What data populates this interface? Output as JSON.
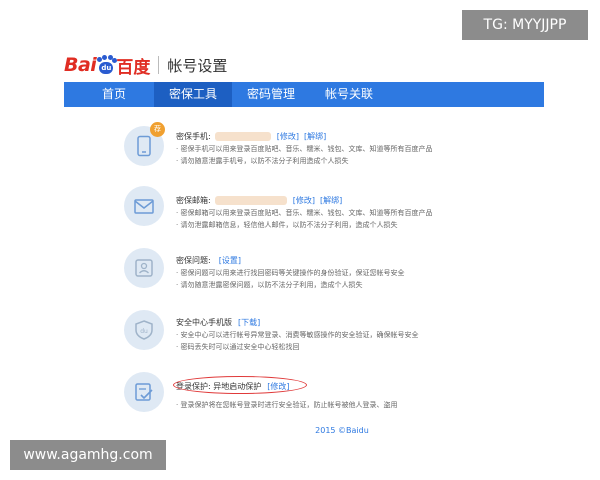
{
  "watermarks": {
    "top": "TG: MYYJJPP",
    "bottom": "www.agamhg.com"
  },
  "header": {
    "logo_latin": "Bai",
    "logo_paw_text": "du",
    "logo_cn": "百度",
    "title": "帐号设置"
  },
  "nav": [
    {
      "label": "首页",
      "active": false
    },
    {
      "label": "密保工具",
      "active": true
    },
    {
      "label": "密码管理",
      "active": false
    },
    {
      "label": "帐号关联",
      "active": false
    }
  ],
  "sections": [
    {
      "icon": "phone-icon",
      "badge": "荐",
      "title": "密保手机:",
      "links": [
        "[修改]",
        "[解绑]"
      ],
      "lines": [
        "· 密保手机可以用来登录百度贴吧、音乐、糯米、钱包、文库、知道等所有百度产品",
        "· 请勿随意泄露手机号，以防不法分子利用造成个人损失"
      ]
    },
    {
      "icon": "mail-icon",
      "title": "密保邮箱:",
      "links": [
        "[修改]",
        "[解绑]"
      ],
      "lines": [
        "· 密保邮箱可以用来登录百度贴吧、音乐、糯米、钱包、文库、知道等所有百度产品",
        "· 请勿泄露邮箱信息，轻信他人邮件，以防不法分子利用，造成个人损失"
      ]
    },
    {
      "icon": "id-card-icon",
      "title": "密保问题:",
      "links": [
        "[设置]"
      ],
      "lines": [
        "· 密保问题可以用来进行找回密码等关键操作的身份验证，保证您帐号安全",
        "· 请勿随意泄露密保问题，以防不法分子利用，造成个人损失"
      ]
    },
    {
      "icon": "shield-du-icon",
      "title": "安全中心手机版",
      "links": [
        "[下载]"
      ],
      "lines": [
        "· 安全中心可以进行帐号异常登录、消费等敏感操作的安全验证，确保帐号安全",
        "· 密码丢失时可以通过安全中心轻松找回"
      ]
    },
    {
      "icon": "login-check-icon",
      "title": "登录保护: 异地启动保护",
      "links": [
        "[修改]"
      ],
      "lines": [
        "· 登录保护将在您帐号登录时进行安全验证，防止帐号被他人登录、盗用"
      ]
    }
  ],
  "footer": {
    "copyright": "2015 ©Baidu"
  },
  "colors": {
    "brand_blue": "#2e79e1",
    "active_blue": "#1d5fc2",
    "logo_red": "#e02d23",
    "icon_bg": "#dfe9f4",
    "highlight_red": "#e03a3a"
  }
}
